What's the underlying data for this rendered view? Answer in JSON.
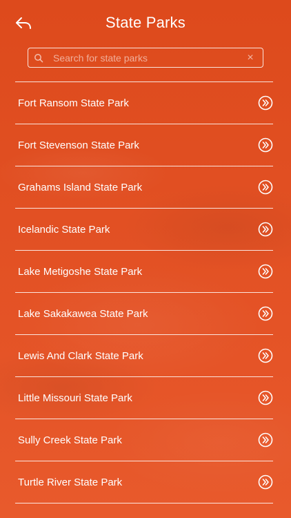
{
  "header": {
    "title": "State Parks",
    "back_icon": "back-arrow-icon"
  },
  "search": {
    "placeholder": "Search for state parks",
    "value": "",
    "clear_label": "×"
  },
  "parks": [
    {
      "label": "Fort Ransom State Park"
    },
    {
      "label": "Fort Stevenson State Park"
    },
    {
      "label": "Grahams Island State Park"
    },
    {
      "label": "Icelandic State Park"
    },
    {
      "label": "Lake Metigoshe State Park"
    },
    {
      "label": "Lake Sakakawea State Park"
    },
    {
      "label": "Lewis And Clark State Park"
    },
    {
      "label": "Little Missouri State Park"
    },
    {
      "label": "Sully Creek State Park"
    },
    {
      "label": "Turtle River State Park"
    }
  ],
  "colors": {
    "background": "#e14f22",
    "foreground": "#ffffff"
  }
}
